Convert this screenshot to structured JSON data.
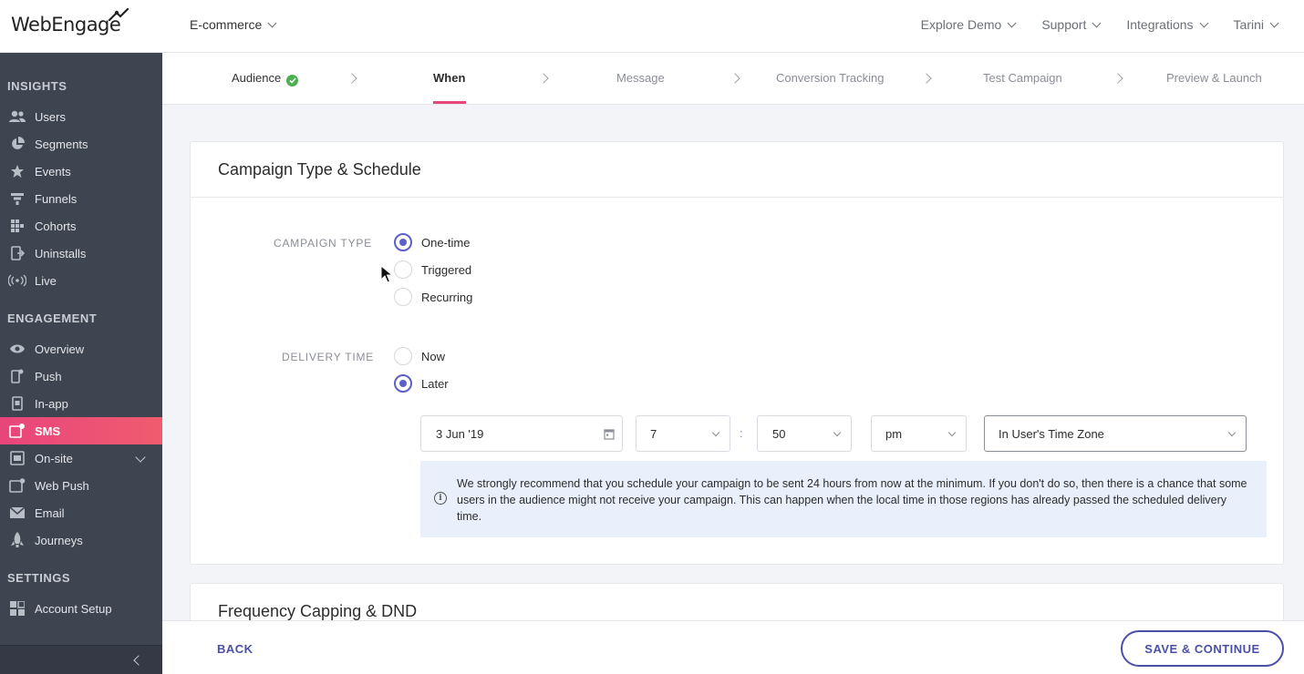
{
  "brand": {
    "logo_text": "WebEngage",
    "accent": "#e8457b",
    "primary": "#4a4fa8",
    "radio_color": "#5b5fc7"
  },
  "header": {
    "project": "E-commerce",
    "nav": [
      "Explore Demo",
      "Support",
      "Integrations",
      "Tarini"
    ]
  },
  "sidebar": {
    "sections": [
      {
        "title": "INSIGHTS",
        "items": [
          {
            "label": "Users",
            "icon": "users-icon"
          },
          {
            "label": "Segments",
            "icon": "pie-chart-icon"
          },
          {
            "label": "Events",
            "icon": "star-icon"
          },
          {
            "label": "Funnels",
            "icon": "funnel-icon"
          },
          {
            "label": "Cohorts",
            "icon": "grid-icon"
          },
          {
            "label": "Uninstalls",
            "icon": "uninstall-icon"
          },
          {
            "label": "Live",
            "icon": "live-broadcast-icon"
          }
        ]
      },
      {
        "title": "ENGAGEMENT",
        "items": [
          {
            "label": "Overview",
            "icon": "eye-icon"
          },
          {
            "label": "Push",
            "icon": "mobile-push-icon"
          },
          {
            "label": "In-app",
            "icon": "in-app-icon"
          },
          {
            "label": "SMS",
            "icon": "sms-icon",
            "active": true
          },
          {
            "label": "On-site",
            "icon": "on-site-icon",
            "expandable": true
          },
          {
            "label": "Web Push",
            "icon": "web-push-icon"
          },
          {
            "label": "Email",
            "icon": "email-icon"
          },
          {
            "label": "Journeys",
            "icon": "rocket-icon"
          }
        ]
      },
      {
        "title": "SETTINGS",
        "items": [
          {
            "label": "Account Setup",
            "icon": "account-setup-icon"
          }
        ]
      }
    ]
  },
  "stepper": {
    "steps": [
      {
        "label": "Audience",
        "state": "done"
      },
      {
        "label": "When",
        "state": "current"
      },
      {
        "label": "Message",
        "state": "todo"
      },
      {
        "label": "Conversion Tracking",
        "state": "todo"
      },
      {
        "label": "Test Campaign",
        "state": "todo"
      },
      {
        "label": "Preview & Launch",
        "state": "todo"
      }
    ]
  },
  "schedule": {
    "title": "Campaign Type & Schedule",
    "campaign_type_label": "CAMPAIGN TYPE",
    "campaign_types": [
      {
        "label": "One-time",
        "selected": true
      },
      {
        "label": "Triggered",
        "selected": false
      },
      {
        "label": "Recurring",
        "selected": false
      }
    ],
    "delivery_time_label": "DELIVERY TIME",
    "delivery_options": [
      {
        "label": "Now",
        "selected": false
      },
      {
        "label": "Later",
        "selected": true
      }
    ],
    "date": "3 Jun '19",
    "hour": "7",
    "separator": ":",
    "minute": "50",
    "ampm": "pm",
    "timezone": "In User's Time Zone",
    "info_text": "We strongly recommend that you schedule your campaign to be sent 24 hours from now at the minimum. If you don't do so, then there is a chance that some users in the audience might not receive your campaign. This can happen when the local time in those regions has already passed the scheduled delivery time."
  },
  "frequency": {
    "title": "Frequency Capping & DND"
  },
  "footer": {
    "back": "BACK",
    "save": "SAVE & CONTINUE"
  }
}
